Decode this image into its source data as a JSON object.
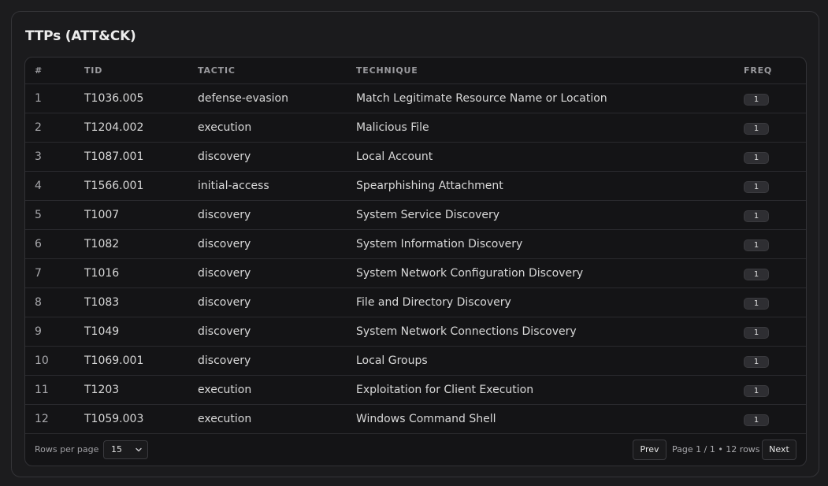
{
  "card": {
    "title": "TTPs (ATT&CK)"
  },
  "table": {
    "headers": {
      "index": "#",
      "tid": "TID",
      "tactic": "TACTIC",
      "technique": "TECHNIQUE",
      "freq": "FREQ"
    },
    "rows": [
      {
        "index": "1",
        "tid": "T1036.005",
        "tactic": "defense-evasion",
        "technique": "Match Legitimate Resource Name or Location",
        "freq": "1"
      },
      {
        "index": "2",
        "tid": "T1204.002",
        "tactic": "execution",
        "technique": "Malicious File",
        "freq": "1"
      },
      {
        "index": "3",
        "tid": "T1087.001",
        "tactic": "discovery",
        "technique": "Local Account",
        "freq": "1"
      },
      {
        "index": "4",
        "tid": "T1566.001",
        "tactic": "initial-access",
        "technique": "Spearphishing Attachment",
        "freq": "1"
      },
      {
        "index": "5",
        "tid": "T1007",
        "tactic": "discovery",
        "technique": "System Service Discovery",
        "freq": "1"
      },
      {
        "index": "6",
        "tid": "T1082",
        "tactic": "discovery",
        "technique": "System Information Discovery",
        "freq": "1"
      },
      {
        "index": "7",
        "tid": "T1016",
        "tactic": "discovery",
        "technique": "System Network Configuration Discovery",
        "freq": "1"
      },
      {
        "index": "8",
        "tid": "T1083",
        "tactic": "discovery",
        "technique": "File and Directory Discovery",
        "freq": "1"
      },
      {
        "index": "9",
        "tid": "T1049",
        "tactic": "discovery",
        "technique": "System Network Connections Discovery",
        "freq": "1"
      },
      {
        "index": "10",
        "tid": "T1069.001",
        "tactic": "discovery",
        "technique": "Local Groups",
        "freq": "1"
      },
      {
        "index": "11",
        "tid": "T1203",
        "tactic": "execution",
        "technique": "Exploitation for Client Execution",
        "freq": "1"
      },
      {
        "index": "12",
        "tid": "T1059.003",
        "tactic": "execution",
        "technique": "Windows Command Shell",
        "freq": "1"
      }
    ]
  },
  "pagination": {
    "rows_per_page_label": "Rows per page",
    "rows_per_page_value": "15",
    "prev_label": "Prev",
    "page_info": "Page 1 / 1 • 12 rows",
    "next_label": "Next"
  },
  "icons": {
    "select_caret": "chevron-down-icon"
  },
  "colors": {
    "background": "#1c1c1e",
    "table_background": "#141416",
    "badge_background": "#2e2e32"
  }
}
